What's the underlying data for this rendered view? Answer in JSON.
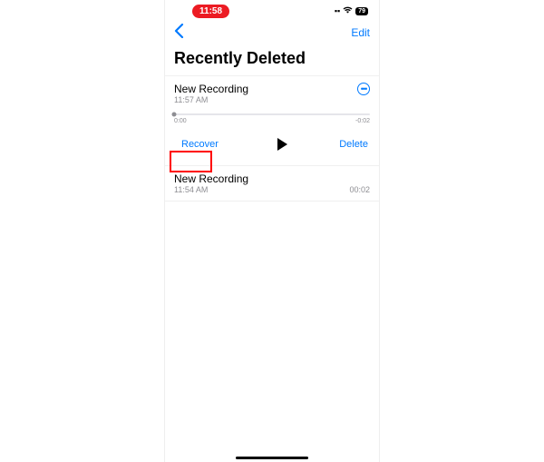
{
  "status": {
    "time": "11:58",
    "battery": "79"
  },
  "nav": {
    "edit_label": "Edit"
  },
  "title": "Recently Deleted",
  "expanded": {
    "title": "New Recording",
    "time": "11:57 AM",
    "slider_start": "0:00",
    "slider_end": "-0:02",
    "recover_label": "Recover",
    "delete_label": "Delete"
  },
  "item2": {
    "title": "New Recording",
    "time": "11:54 AM",
    "duration": "00:02"
  }
}
